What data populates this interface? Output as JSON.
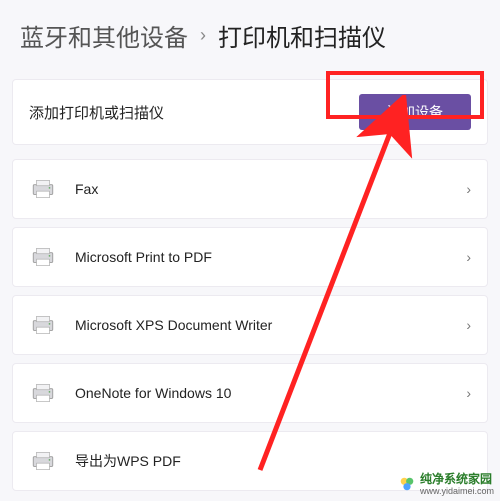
{
  "breadcrumb": {
    "parent": "蓝牙和其他设备",
    "sep": "›",
    "current": "打印机和扫描仪"
  },
  "add": {
    "label": "添加打印机或扫描仪",
    "button": "添加设备"
  },
  "devices": [
    {
      "name": "Fax"
    },
    {
      "name": "Microsoft Print to PDF"
    },
    {
      "name": "Microsoft XPS Document Writer"
    },
    {
      "name": "OneNote for Windows 10"
    },
    {
      "name": "导出为WPS PDF"
    }
  ],
  "watermark": {
    "site": "纯净系统家园",
    "url": "www.yidaimei.com"
  }
}
